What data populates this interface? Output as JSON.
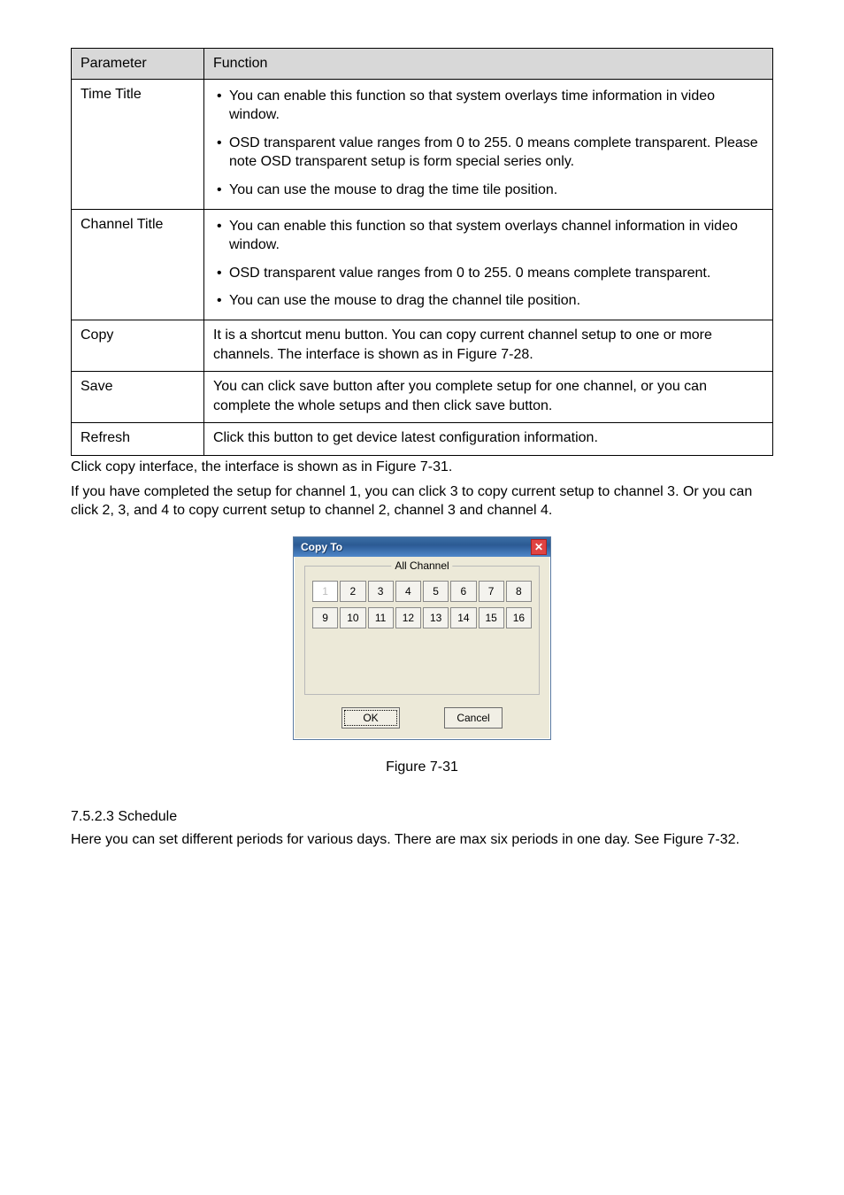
{
  "table": {
    "headers": {
      "c1": "Parameter",
      "c2": "Function"
    },
    "rows": [
      {
        "param": "Time Title",
        "bullets": [
          "You can enable this function so that system overlays time information in video window.",
          "OSD transparent value ranges from 0 to 255. 0 means complete transparent. Please note OSD transparent setup is form special series only.",
          "You can use the mouse to drag the time tile position."
        ]
      },
      {
        "param": "Channel Title",
        "bullets": [
          "You can enable this function so that system overlays channel information in video window.",
          "OSD transparent value ranges from 0 to 255. 0 means complete transparent.",
          "You can use the mouse to drag the channel tile position."
        ]
      },
      {
        "param": "Copy",
        "text": "It is a shortcut menu button. You can copy current channel setup to one or more channels.  The interface is shown as in Figure 7-28."
      },
      {
        "param": "Save",
        "text": "You can click save button after you complete setup for one channel, or you can complete the whole setups and then click save button."
      },
      {
        "param": "Refresh",
        "text": "Click this button to get device latest configuration information."
      }
    ]
  },
  "paragraphs": [
    "Click copy interface, the interface is shown as in Figure 7-31.",
    "If you have completed the setup for channel 1, you can click 3 to copy current setup to channel 3. Or you can click 2, 3, and 4 to copy current setup to channel 2, channel 3 and channel 4."
  ],
  "dialog": {
    "title": "Copy To",
    "group_label": "All Channel",
    "channels_row1": [
      "1",
      "2",
      "3",
      "4",
      "5",
      "6",
      "7",
      "8"
    ],
    "channels_row2": [
      "9",
      "10",
      "11",
      "12",
      "13",
      "14",
      "15",
      "16"
    ],
    "disabled_index": 0,
    "ok": "OK",
    "cancel": "Cancel",
    "close_symbol": "✕"
  },
  "figure_caption": "Figure 7-31",
  "section": {
    "number_title": "7.5.2.3  Schedule",
    "text": "Here you can set different periods for various days. There are max six periods in one day. See Figure 7-32."
  }
}
